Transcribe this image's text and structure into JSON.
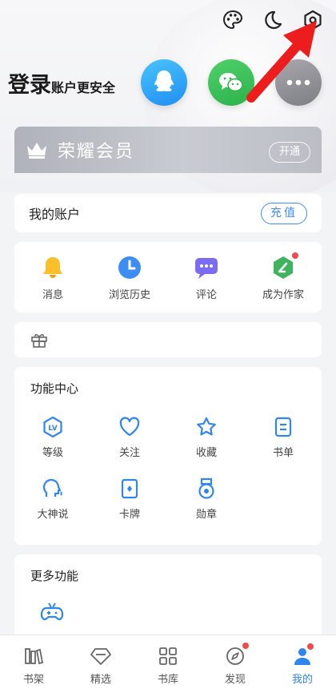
{
  "header": {
    "icons": [
      "palette-icon",
      "moon-icon",
      "settings-hexagon-icon"
    ],
    "login_title_big": "登录",
    "login_title_small": "账户更安全",
    "login_options": [
      "qq-icon",
      "wechat-icon",
      "more-icon"
    ]
  },
  "vip": {
    "title": "荣耀会员",
    "button": "开通"
  },
  "account": {
    "label": "我的账户",
    "recharge": "充值"
  },
  "quick_actions": [
    {
      "label": "消息",
      "icon": "bell-icon"
    },
    {
      "label": "浏览历史",
      "icon": "clock-icon"
    },
    {
      "label": "评论",
      "icon": "comment-icon"
    },
    {
      "label": "成为作家",
      "icon": "pen-icon"
    }
  ],
  "gift": {
    "icon": "gift-icon"
  },
  "function_center": {
    "title": "功能中心",
    "items": [
      {
        "label": "等级",
        "icon": "level-icon"
      },
      {
        "label": "关注",
        "icon": "heart-icon"
      },
      {
        "label": "收藏",
        "icon": "star-icon"
      },
      {
        "label": "书单",
        "icon": "booklist-icon"
      },
      {
        "label": "大神说",
        "icon": "speaker-head-icon"
      },
      {
        "label": "卡牌",
        "icon": "card-icon"
      },
      {
        "label": "勋章",
        "icon": "medal-icon"
      }
    ]
  },
  "more_functions": {
    "title": "更多功能",
    "items": [
      {
        "icon": "gamepad-icon"
      }
    ]
  },
  "tabbar": {
    "items": [
      {
        "label": "书架",
        "icon": "bookshelf-icon",
        "active": false
      },
      {
        "label": "精选",
        "icon": "diamond-icon",
        "active": false
      },
      {
        "label": "书库",
        "icon": "grid-icon",
        "active": false
      },
      {
        "label": "发现",
        "icon": "compass-icon",
        "active": false
      },
      {
        "label": "我的",
        "icon": "person-icon",
        "active": true
      }
    ]
  },
  "colors": {
    "accent": "#2f86ee",
    "badge": "#f04a4a",
    "vip_bg": "#c3c5cc"
  }
}
